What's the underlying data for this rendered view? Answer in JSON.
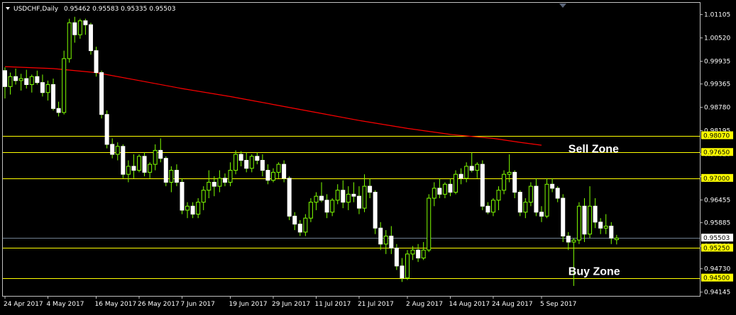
{
  "header": {
    "symbol_period": "USDCHF,Daily",
    "quote": "0.95462 0.95583 0.95335 0.95503"
  },
  "colors": {
    "background": "#000000",
    "frame": "#c0c0c0",
    "candle_up_body": "#000000",
    "candle_up_outline": "#7fff00",
    "candle_down_body": "#ffffff",
    "wick": "#7fff00",
    "moving_average": "#ff0000",
    "level_line": "#ffff00",
    "level_tag_bg": "#ffff00",
    "price_tag_bg": "#ffffff",
    "axis_text": "#ffffff"
  },
  "chart_data": {
    "type": "candlestick",
    "ylim": [
      0.9405,
      1.014
    ],
    "y_ticks": [
      "1.01105",
      "1.00520",
      "0.99935",
      "0.99365",
      "0.98780",
      "0.98195",
      "0.97610",
      "0.97040",
      "0.96455",
      "0.95885",
      "0.95300",
      "0.94730",
      "0.94145"
    ],
    "x_ticks": [
      {
        "label": "24 Apr 2017",
        "index": 0
      },
      {
        "label": "4 May 2017",
        "index": 8
      },
      {
        "label": "16 May 2017",
        "index": 17
      },
      {
        "label": "26 May 2017",
        "index": 25
      },
      {
        "label": "7 Jun 2017",
        "index": 33
      },
      {
        "label": "19 Jun 2017",
        "index": 42
      },
      {
        "label": "29 Jun 2017",
        "index": 50
      },
      {
        "label": "11 Jul 2017",
        "index": 58
      },
      {
        "label": "21 Jul 2017",
        "index": 66
      },
      {
        "label": "2 Aug 2017",
        "index": 75
      },
      {
        "label": "14 Aug 2017",
        "index": 83
      },
      {
        "label": "24 Aug 2017",
        "index": 91
      },
      {
        "label": "5 Sep 2017",
        "index": 100
      }
    ],
    "candles": [
      [
        0.997,
        0.9978,
        0.99,
        0.993
      ],
      [
        0.993,
        0.9965,
        0.991,
        0.9955
      ],
      [
        0.9955,
        0.9975,
        0.9935,
        0.9945
      ],
      [
        0.9945,
        0.9962,
        0.992,
        0.995
      ],
      [
        0.995,
        0.9972,
        0.9925,
        0.9935
      ],
      [
        0.9935,
        0.996,
        0.9915,
        0.9955
      ],
      [
        0.9955,
        0.997,
        0.9935,
        0.994
      ],
      [
        0.994,
        0.996,
        0.9905,
        0.9915
      ],
      [
        0.9915,
        0.9945,
        0.9895,
        0.9935
      ],
      [
        0.9935,
        0.995,
        0.987,
        0.9875
      ],
      [
        0.9875,
        0.9892,
        0.9855,
        0.9865
      ],
      [
        0.9865,
        1.002,
        0.986,
        1.0
      ],
      [
        1.0,
        1.01,
        0.999,
        1.009
      ],
      [
        1.009,
        1.0105,
        1.004,
        1.006
      ],
      [
        1.006,
        1.01,
        1.005,
        1.0095
      ],
      [
        1.0095,
        1.01,
        1.006,
        1.0085
      ],
      [
        1.0085,
        1.009,
        1.001,
        1.002
      ],
      [
        1.002,
        1.003,
        0.9955,
        0.9965
      ],
      [
        0.9965,
        0.997,
        0.985,
        0.986
      ],
      [
        0.986,
        0.987,
        0.9775,
        0.9785
      ],
      [
        0.9785,
        0.98,
        0.975,
        0.976
      ],
      [
        0.976,
        0.979,
        0.9745,
        0.978
      ],
      [
        0.978,
        0.9785,
        0.97,
        0.971
      ],
      [
        0.971,
        0.9745,
        0.969,
        0.973
      ],
      [
        0.973,
        0.976,
        0.97,
        0.972
      ],
      [
        0.972,
        0.976,
        0.9715,
        0.9755
      ],
      [
        0.9755,
        0.9765,
        0.9705,
        0.9715
      ],
      [
        0.9715,
        0.974,
        0.97,
        0.9735
      ],
      [
        0.9735,
        0.9785,
        0.972,
        0.977
      ],
      [
        0.977,
        0.98,
        0.974,
        0.975
      ],
      [
        0.975,
        0.9755,
        0.968,
        0.969
      ],
      [
        0.969,
        0.973,
        0.9665,
        0.972
      ],
      [
        0.972,
        0.9735,
        0.968,
        0.969
      ],
      [
        0.969,
        0.97,
        0.961,
        0.962
      ],
      [
        0.962,
        0.964,
        0.96,
        0.963
      ],
      [
        0.963,
        0.964,
        0.96,
        0.961
      ],
      [
        0.961,
        0.965,
        0.96,
        0.964
      ],
      [
        0.964,
        0.968,
        0.962,
        0.967
      ],
      [
        0.967,
        0.972,
        0.965,
        0.969
      ],
      [
        0.969,
        0.9705,
        0.9655,
        0.968
      ],
      [
        0.968,
        0.972,
        0.9665,
        0.97
      ],
      [
        0.97,
        0.9712,
        0.968,
        0.969
      ],
      [
        0.969,
        0.974,
        0.968,
        0.972
      ],
      [
        0.972,
        0.977,
        0.971,
        0.976
      ],
      [
        0.976,
        0.9768,
        0.973,
        0.9745
      ],
      [
        0.9745,
        0.9765,
        0.9715,
        0.9725
      ],
      [
        0.9725,
        0.976,
        0.9715,
        0.9755
      ],
      [
        0.9755,
        0.9765,
        0.9735,
        0.9745
      ],
      [
        0.9745,
        0.976,
        0.9705,
        0.972
      ],
      [
        0.972,
        0.9735,
        0.9685,
        0.9695
      ],
      [
        0.9695,
        0.9725,
        0.969,
        0.9715
      ],
      [
        0.9715,
        0.974,
        0.97,
        0.9735
      ],
      [
        0.9735,
        0.9745,
        0.969,
        0.97
      ],
      [
        0.97,
        0.9705,
        0.9595,
        0.9605
      ],
      [
        0.9605,
        0.9615,
        0.957,
        0.9585
      ],
      [
        0.9585,
        0.9595,
        0.9555,
        0.9565
      ],
      [
        0.9565,
        0.961,
        0.9555,
        0.96
      ],
      [
        0.96,
        0.965,
        0.959,
        0.964
      ],
      [
        0.964,
        0.9665,
        0.962,
        0.9655
      ],
      [
        0.9655,
        0.969,
        0.964,
        0.9645
      ],
      [
        0.9645,
        0.966,
        0.96,
        0.9615
      ],
      [
        0.9615,
        0.965,
        0.9605,
        0.9645
      ],
      [
        0.9645,
        0.9685,
        0.9635,
        0.967
      ],
      [
        0.967,
        0.9695,
        0.9625,
        0.964
      ],
      [
        0.964,
        0.968,
        0.962,
        0.966
      ],
      [
        0.966,
        0.969,
        0.964,
        0.9655
      ],
      [
        0.9655,
        0.968,
        0.961,
        0.9625
      ],
      [
        0.9625,
        0.971,
        0.9615,
        0.968
      ],
      [
        0.968,
        0.97,
        0.965,
        0.9665
      ],
      [
        0.9665,
        0.967,
        0.956,
        0.9575
      ],
      [
        0.9575,
        0.959,
        0.952,
        0.9535
      ],
      [
        0.9535,
        0.957,
        0.951,
        0.9555
      ],
      [
        0.9555,
        0.958,
        0.951,
        0.9525
      ],
      [
        0.9525,
        0.9535,
        0.947,
        0.948
      ],
      [
        0.948,
        0.95,
        0.944,
        0.945
      ],
      [
        0.945,
        0.952,
        0.9445,
        0.951
      ],
      [
        0.951,
        0.953,
        0.9495,
        0.952
      ],
      [
        0.952,
        0.9535,
        0.949,
        0.95
      ],
      [
        0.95,
        0.954,
        0.9495,
        0.952
      ],
      [
        0.952,
        0.966,
        0.9515,
        0.965
      ],
      [
        0.965,
        0.969,
        0.963,
        0.9675
      ],
      [
        0.9675,
        0.97,
        0.965,
        0.966
      ],
      [
        0.966,
        0.969,
        0.965,
        0.9685
      ],
      [
        0.9685,
        0.97,
        0.9655,
        0.9665
      ],
      [
        0.9665,
        0.972,
        0.966,
        0.971
      ],
      [
        0.971,
        0.9725,
        0.9685,
        0.97
      ],
      [
        0.97,
        0.974,
        0.969,
        0.973
      ],
      [
        0.973,
        0.9765,
        0.9715,
        0.972
      ],
      [
        0.972,
        0.974,
        0.97,
        0.9735
      ],
      [
        0.9735,
        0.9745,
        0.962,
        0.963
      ],
      [
        0.963,
        0.964,
        0.961,
        0.9615
      ],
      [
        0.9615,
        0.965,
        0.9605,
        0.9645
      ],
      [
        0.9645,
        0.968,
        0.962,
        0.967
      ],
      [
        0.967,
        0.972,
        0.966,
        0.971
      ],
      [
        0.971,
        0.976,
        0.969,
        0.9715
      ],
      [
        0.9715,
        0.972,
        0.965,
        0.9665
      ],
      [
        0.9665,
        0.967,
        0.9605,
        0.9615
      ],
      [
        0.9615,
        0.965,
        0.96,
        0.964
      ],
      [
        0.964,
        0.969,
        0.963,
        0.968
      ],
      [
        0.968,
        0.97,
        0.9605,
        0.9615
      ],
      [
        0.9615,
        0.963,
        0.959,
        0.9605
      ],
      [
        0.9605,
        0.97,
        0.96,
        0.9685
      ],
      [
        0.9685,
        0.97,
        0.9665,
        0.9675
      ],
      [
        0.9675,
        0.968,
        0.964,
        0.965
      ],
      [
        0.965,
        0.966,
        0.954,
        0.9555
      ],
      [
        0.9555,
        0.9565,
        0.952,
        0.954
      ],
      [
        0.954,
        0.955,
        0.943,
        0.9545
      ],
      [
        0.9545,
        0.964,
        0.9535,
        0.963
      ],
      [
        0.963,
        0.965,
        0.954,
        0.956
      ],
      [
        0.956,
        0.968,
        0.955,
        0.963
      ],
      [
        0.963,
        0.965,
        0.9575,
        0.959
      ],
      [
        0.959,
        0.96,
        0.956,
        0.9575
      ],
      [
        0.9575,
        0.961,
        0.956,
        0.958
      ],
      [
        0.958,
        0.959,
        0.9535,
        0.955
      ],
      [
        0.9546,
        0.9558,
        0.9534,
        0.955
      ]
    ],
    "moving_average": [
      [
        0,
        0.998
      ],
      [
        9,
        0.9975
      ],
      [
        17,
        0.9965
      ],
      [
        25,
        0.9945
      ],
      [
        33,
        0.9925
      ],
      [
        42,
        0.9905
      ],
      [
        50,
        0.9885
      ],
      [
        58,
        0.9865
      ],
      [
        66,
        0.9845
      ],
      [
        75,
        0.9825
      ],
      [
        83,
        0.981
      ],
      [
        91,
        0.98
      ],
      [
        96,
        0.979
      ],
      [
        100,
        0.9783
      ]
    ],
    "levels": [
      {
        "value": 0.9807,
        "label": "0.98070"
      },
      {
        "value": 0.9765,
        "label": "0.97650"
      },
      {
        "value": 0.97,
        "label": "0.97000"
      },
      {
        "value": 0.9525,
        "label": "0.95250"
      },
      {
        "value": 0.945,
        "label": "0.94500"
      }
    ],
    "current_price": {
      "value": 0.95503,
      "label": "0.95503"
    },
    "annotations": [
      {
        "text": "Sell Zone",
        "y": 0.9775,
        "index": 105
      },
      {
        "text": "Buy Zone",
        "y": 0.9468,
        "index": 105
      }
    ]
  }
}
